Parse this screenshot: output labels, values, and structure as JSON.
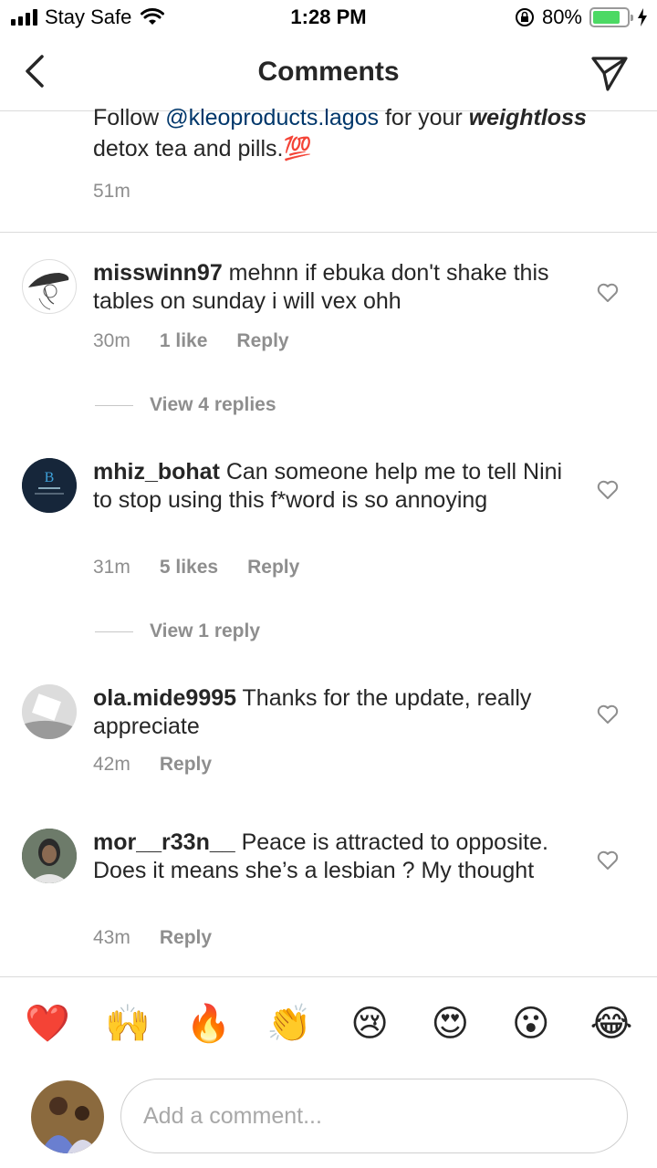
{
  "status_bar": {
    "carrier": "Stay Safe",
    "time": "1:28 PM",
    "battery_percent": "80%",
    "battery_level": 0.8
  },
  "nav": {
    "title": "Comments",
    "back_icon": "chevron-left-icon",
    "share_icon": "paper-plane-icon"
  },
  "caption": {
    "prefix": "Follow ",
    "mention": "@kleoproducts.lagos",
    "middle": " for your ",
    "emphasis": "weightloss",
    "suffix": " detox tea and pills.",
    "emoji": "💯",
    "time": "51m"
  },
  "comments": [
    {
      "username": "misswinn97",
      "text": " mehnn if ebuka don't shake this tables on sunday i will vex ohh",
      "time": "30m",
      "likes": "1 like",
      "reply": "Reply",
      "view_replies": "View 4 replies"
    },
    {
      "username": "mhiz_bohat",
      "text": " Can someone help me to tell Nini to stop using this f*word is so annoying",
      "time": "31m",
      "likes": "5 likes",
      "reply": "Reply",
      "view_replies": "View 1 reply"
    },
    {
      "username": "ola.mide9995",
      "text": " Thanks for the update, really appreciate",
      "time": "42m",
      "reply": "Reply"
    },
    {
      "username": "mor__r33n__",
      "text": " Peace is attracted to opposite. Does it means she’s a lesbian ? My thought",
      "time": "43m",
      "reply": "Reply"
    }
  ],
  "emoji_bar": {
    "items": [
      "❤️",
      "🙌",
      "🔥",
      "👏",
      "😢",
      "😍",
      "😮",
      "😂"
    ]
  },
  "input": {
    "placeholder": "Add a comment..."
  },
  "colors": {
    "link": "#00376b",
    "muted": "#8e8e8e",
    "battery": "#4cd964",
    "divider": "#dbdbdb"
  }
}
